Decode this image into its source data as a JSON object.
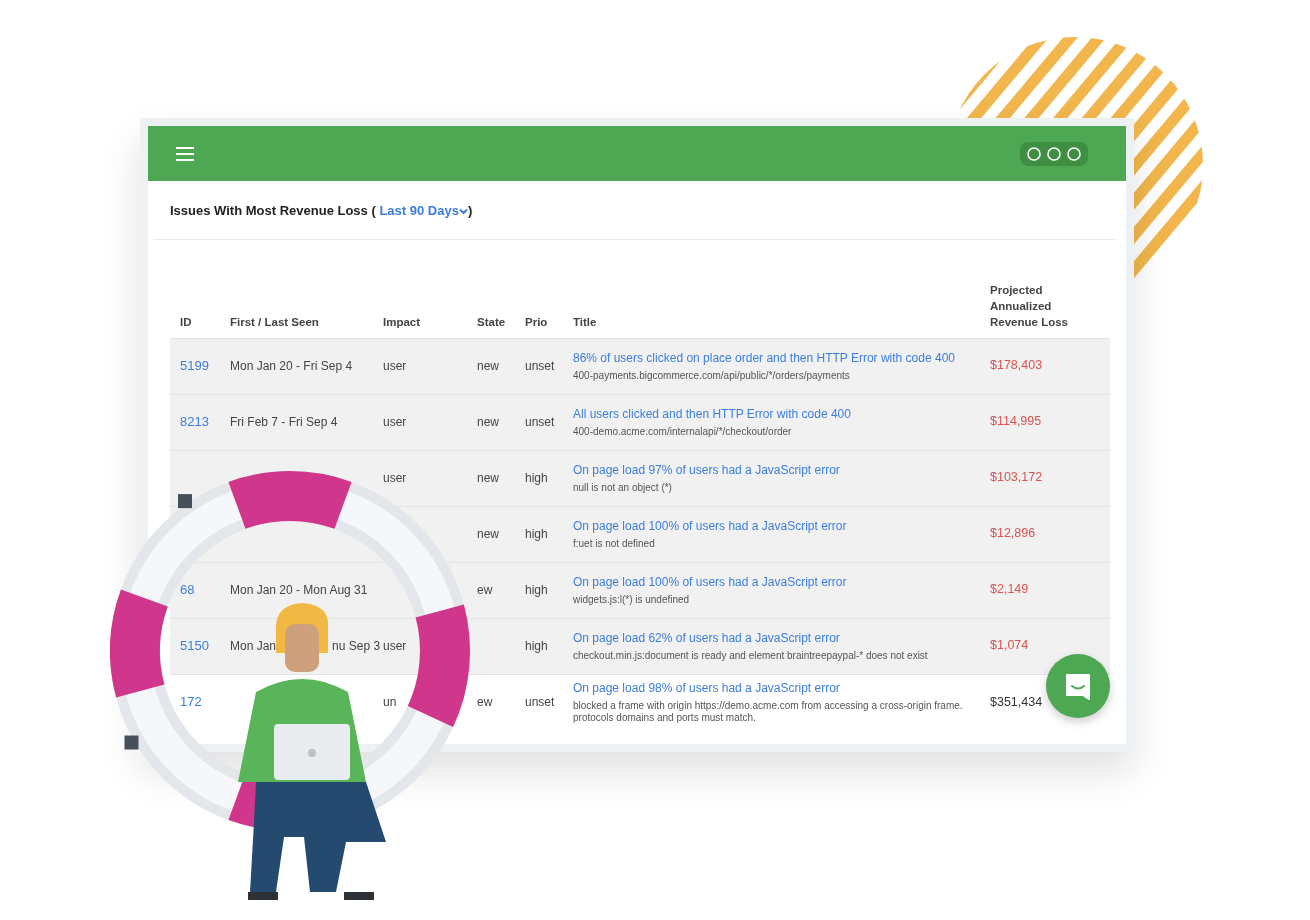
{
  "panel": {
    "title": "Issues With Most Revenue Loss (",
    "period": "Last 90 Days",
    "title_end": ")"
  },
  "table": {
    "columns": [
      "ID",
      "First / Last Seen",
      "Impact",
      "State",
      "Prio",
      "Title",
      "Projected Annualized Revenue Loss"
    ],
    "rows": [
      {
        "id": "5199",
        "seen": "Mon Jan 20 - Fri Sep 4",
        "impact": "user",
        "state": "new",
        "prio": "unset",
        "title": "86% of users clicked on place order and then HTTP Error with code 400",
        "detail": "400-payments.bigcommerce.com/api/public/*/orders/payments",
        "loss": "$178,403",
        "color": "#d9534f",
        "highlighted": true
      },
      {
        "id": "8213",
        "seen": "Fri Feb 7 - Fri Sep 4",
        "impact": "user",
        "state": "new",
        "prio": "unset",
        "title": "All users clicked and then HTTP Error with code 400",
        "detail": "400-demo.acme.com/internalapi/*/checkout/order",
        "loss": "$114,995",
        "color": "#d9534f",
        "highlighted": true
      },
      {
        "impact": "user",
        "state": "new",
        "prio": "high",
        "title": "On page load 97% of users had a JavaScript error",
        "detail": "null is not an object (*)",
        "loss": "$103,172",
        "color": "#d9534f",
        "highlighted": true
      },
      {
        "state": "new",
        "prio": "high",
        "title": "On page load 100% of users had a JavaScript error",
        "detail": "f:uet is not defined",
        "loss": "$12,896",
        "color": "#d9534f",
        "highlighted": true
      },
      {
        "id": "68",
        "seen": "Mon Jan 20 - Mon Aug 31",
        "state": "ew",
        "prio": "high",
        "title": "On page load 100% of users had a JavaScript error",
        "detail": "widgets.js:l(*) is undefined",
        "loss": "$2,149",
        "color": "#d9534f",
        "highlighted": true
      },
      {
        "id": "5150",
        "seen": [
          "Mon Jan",
          "nu Sep 3"
        ],
        "impact": "user",
        "prio": "high",
        "title": "On page load 62% of users had a JavaScript error",
        "detail": "checkout.min.js:document is ready and element braintreepaypal-* does not exist",
        "loss": "$1,074",
        "color": "#d9534f",
        "highlighted": true
      },
      {
        "id": "172",
        "impact": "un",
        "state": "ew",
        "prio": "unset",
        "title": "On page load 98% of users had a JavaScript error",
        "detail": "blocked a frame with origin https://demo.acme.com from accessing a cross-origin frame. protocols domains and ports must match.",
        "loss": "$351,434",
        "color": "#333333",
        "highlighted": false
      }
    ]
  }
}
